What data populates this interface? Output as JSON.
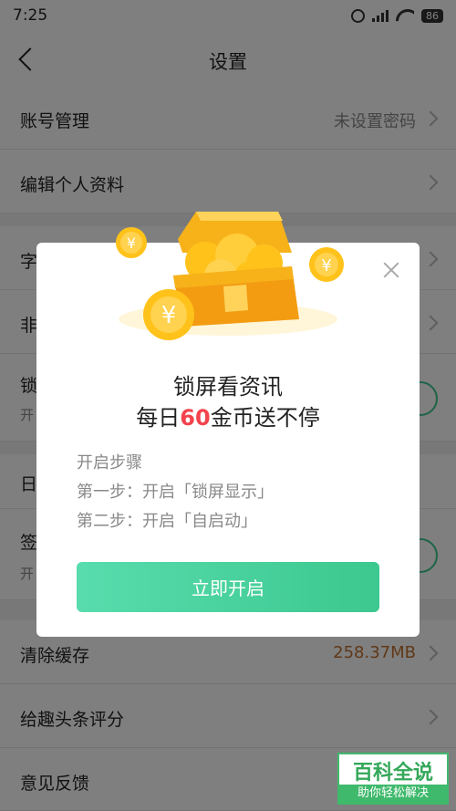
{
  "status_bar": {
    "time": "7:25",
    "battery": "86"
  },
  "nav": {
    "title": "设置"
  },
  "settings": {
    "account": {
      "label": "账号管理",
      "value": "未设置密码"
    },
    "edit_profile": {
      "label": "编辑个人资料"
    },
    "row3": {
      "label": "字"
    },
    "row4": {
      "label": "非"
    },
    "row5": {
      "label": "锁",
      "sub": "开"
    },
    "row6": {
      "label": "日"
    },
    "row7": {
      "label": "签",
      "sub": "开"
    },
    "clear_cache": {
      "label": "清除缓存",
      "value": "258.37MB"
    },
    "rate": {
      "label": "给趣头条评分"
    },
    "feedback": {
      "label": "意见反馈"
    }
  },
  "modal": {
    "title_line1": "锁屏看资讯",
    "title_line2_prefix": "每日",
    "title_line2_highlight": "60",
    "title_line2_suffix": "金币送不停",
    "steps_title": "开启步骤",
    "step1": "第一步：开启「锁屏显示」",
    "step2": "第二步：开启「自启动」",
    "button_label": "立即开启",
    "coin_symbol": "¥"
  },
  "watermark": {
    "line1": "百科全说",
    "line2": "助你轻松解决"
  },
  "colors": {
    "accent_green": "#3cc88e",
    "highlight_red": "#f3434c",
    "cache_value": "#c0712e",
    "coin_gold": "#ffc21a"
  }
}
